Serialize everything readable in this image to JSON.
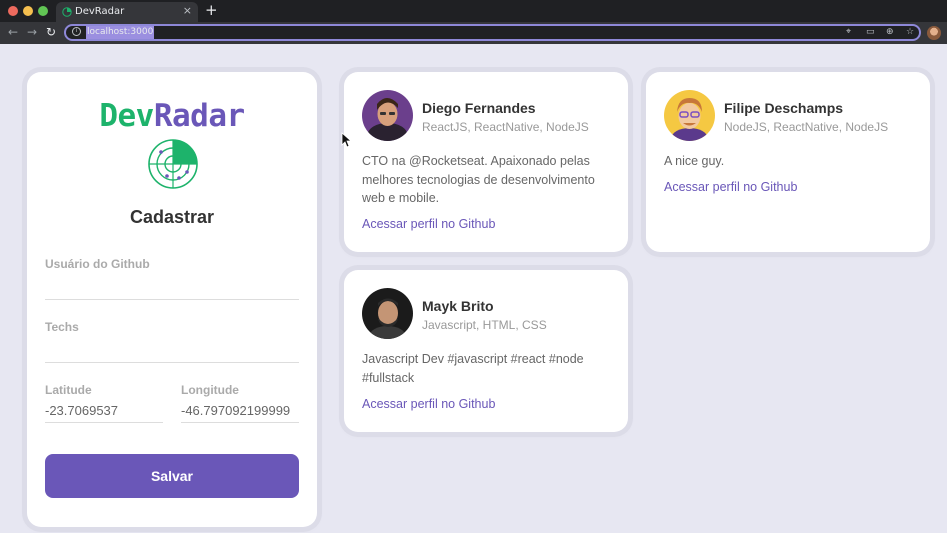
{
  "browser": {
    "tab_title": "DevRadar",
    "tab_close": "×",
    "new_tab": "+",
    "url": "localhost:3000",
    "nav": {
      "back": "←",
      "forward": "→",
      "reload": "↻"
    },
    "omnibox_icons": [
      "location-icon",
      "cast-icon",
      "zoom-icon",
      "star-icon"
    ]
  },
  "form": {
    "logo_dev": "Dev",
    "logo_radar": "Radar",
    "title": "Cadastrar",
    "github_label": "Usuário do Github",
    "github_value": "",
    "techs_label": "Techs",
    "techs_value": "",
    "latitude_label": "Latitude",
    "latitude_value": "-23.7069537",
    "longitude_label": "Longitude",
    "longitude_value": "-46.797092199999",
    "save_label": "Salvar"
  },
  "devs": [
    {
      "name": "Diego Fernandes",
      "techs": "ReactJS, ReactNative, NodeJS",
      "bio": "CTO na @Rocketseat. Apaixonado pelas melhores tecnologias de desenvolvimento web e mobile.",
      "link": "Acessar perfil no Github"
    },
    {
      "name": "Filipe Deschamps",
      "techs": "NodeJS, ReactNative, NodeJS",
      "bio": "A nice guy.",
      "link": "Acessar perfil no Github"
    },
    {
      "name": "Mayk Brito",
      "techs": "Javascript, HTML, CSS",
      "bio": "Javascript Dev #javascript #react #node #fullstack",
      "link": "Acessar perfil no Github"
    }
  ],
  "colors": {
    "background": "#e7e7f2",
    "brand_green": "#1db36b",
    "brand_purple": "#6a57b8",
    "card": "#ffffff"
  }
}
